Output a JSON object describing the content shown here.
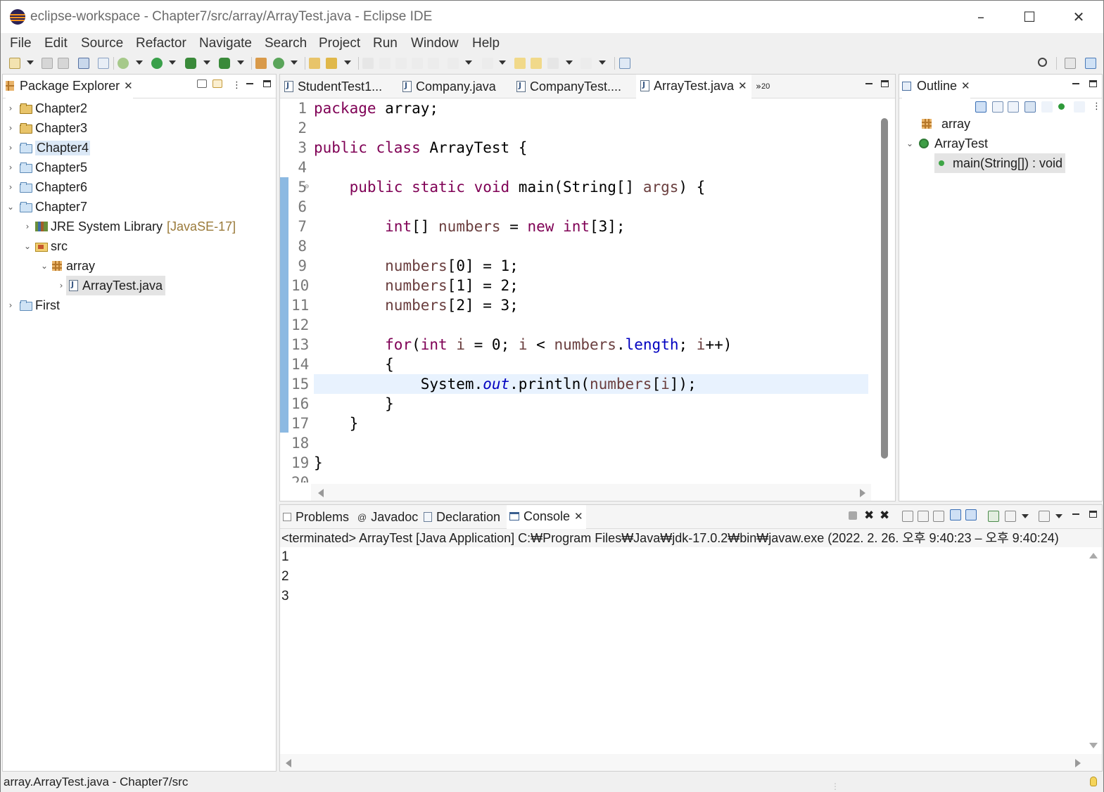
{
  "window": {
    "title": "eclipse-workspace - Chapter7/src/array/ArrayTest.java - Eclipse IDE"
  },
  "menu": [
    "File",
    "Edit",
    "Source",
    "Refactor",
    "Navigate",
    "Search",
    "Project",
    "Run",
    "Window",
    "Help"
  ],
  "package_explorer": {
    "title": "Package Explorer",
    "projects": {
      "chapter2": "Chapter2",
      "chapter3": "Chapter3",
      "chapter4": "Chapter4",
      "chapter5": "Chapter5",
      "chapter6": "Chapter6",
      "chapter7": "Chapter7",
      "first": "First"
    },
    "jre_library": "JRE System Library",
    "jre_version": "[JavaSE-17]",
    "src": "src",
    "package": "array",
    "file": "ArrayTest.java"
  },
  "editor": {
    "tabs": [
      "StudentTest1...",
      "Company.java",
      "CompanyTest....",
      "ArrayTest.java"
    ],
    "active_tab": "ArrayTest.java",
    "overflow_count": "20",
    "line_numbers": [
      "1",
      "2",
      "3",
      "4",
      "5",
      "6",
      "7",
      "8",
      "9",
      "10",
      "11",
      "12",
      "13",
      "14",
      "15",
      "16",
      "17",
      "18",
      "19",
      "20"
    ],
    "current_line": 15
  },
  "outline": {
    "title": "Outline",
    "package": "array",
    "class": "ArrayTest",
    "method": "main(String[]) : void"
  },
  "bottom_tabs": {
    "problems": "Problems",
    "javadoc": "Javadoc",
    "declaration": "Declaration",
    "console": "Console"
  },
  "console": {
    "header": "<terminated> ArrayTest [Java Application] C:₩Program Files₩Java₩jdk-17.0.2₩bin₩javaw.exe  (2022. 2. 26. 오후 9:40:23 – 오후 9:40:24)",
    "output": [
      "1",
      "2",
      "3"
    ]
  },
  "status_bar": {
    "text": "array.ArrayTest.java - Chapter7/src"
  },
  "colors": {
    "keyword": "#7f0055",
    "variable": "#6a3e3e",
    "field": "#0000c0",
    "current_line": "#e8f2fe",
    "selection": "#dbe8f6"
  }
}
